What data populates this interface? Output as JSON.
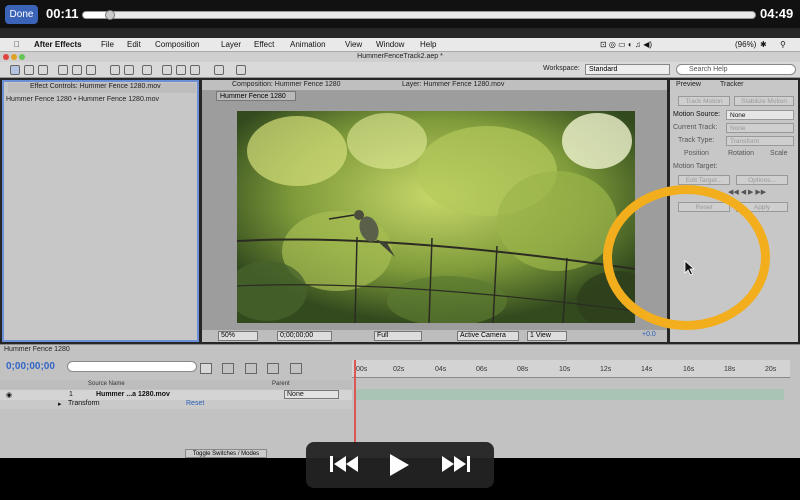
{
  "player": {
    "done_label": "Done",
    "time_elapsed": "00:11",
    "time_remaining": "04:49",
    "progress": 0.04
  },
  "menubar": {
    "app_name": "After Effects",
    "items": [
      "File",
      "Edit",
      "Composition",
      "Layer",
      "Effect",
      "Animation",
      "View",
      "Window",
      "Help"
    ],
    "battery": "(96%)"
  },
  "window_title": "HummerFenceTrack2.aep *",
  "toolbar": {
    "workspace_label": "Workspace:",
    "workspace_value": "Standard",
    "search_placeholder": "Search Help"
  },
  "effect_controls": {
    "tab": "Effect Controls: Hummer Fence 1280.mov",
    "breadcrumb": "Hummer Fence 1280 • Hummer Fence 1280.mov"
  },
  "composition": {
    "tab": "Composition: Hummer Fence 1280",
    "layer_tab": "Layer: Hummer Fence 1280.mov",
    "name_button": "Hummer Fence 1280",
    "footer": {
      "zoom": "50%",
      "timecode": "0;00;00;00",
      "resolution": "Full",
      "camera": "Active Camera",
      "views": "1 View",
      "exposure": "+0.0"
    }
  },
  "tracker": {
    "tabs": [
      "Preview",
      "Tracker"
    ],
    "track_motion": "Track Motion",
    "stabilize_motion": "Stabilize Motion",
    "motion_source_label": "Motion Source:",
    "motion_source_value": "None",
    "current_track_label": "Current Track:",
    "current_track_value": "None",
    "track_type_label": "Track Type:",
    "track_type_value": "Transform",
    "checks": [
      "Position",
      "Rotation",
      "Scale"
    ],
    "motion_target": "Motion Target:",
    "edit_target": "Edit Target...",
    "options": "Options...",
    "analyze": "Analyze:",
    "reset": "Reset",
    "apply": "Apply"
  },
  "timeline": {
    "tab": "Hummer Fence 1280",
    "timecode": "0;00;00;00",
    "ticks": [
      "00s",
      "02s",
      "04s",
      "06s",
      "08s",
      "10s",
      "12s",
      "14s",
      "16s",
      "18s",
      "20s"
    ],
    "col_source": "Source Name",
    "col_parent": "Parent",
    "layer_index": "1",
    "layer_name": "Hummer ...a 1280.mov",
    "layer_parent": "None",
    "transform_label": "Transform",
    "transform_reset": "Reset",
    "toggle_label": "Toggle Switches / Modes"
  },
  "colors": {
    "highlight_circle": "#f2ae1d",
    "timecode_blue": "#3466c8",
    "done_blue": "#3b63b8"
  }
}
